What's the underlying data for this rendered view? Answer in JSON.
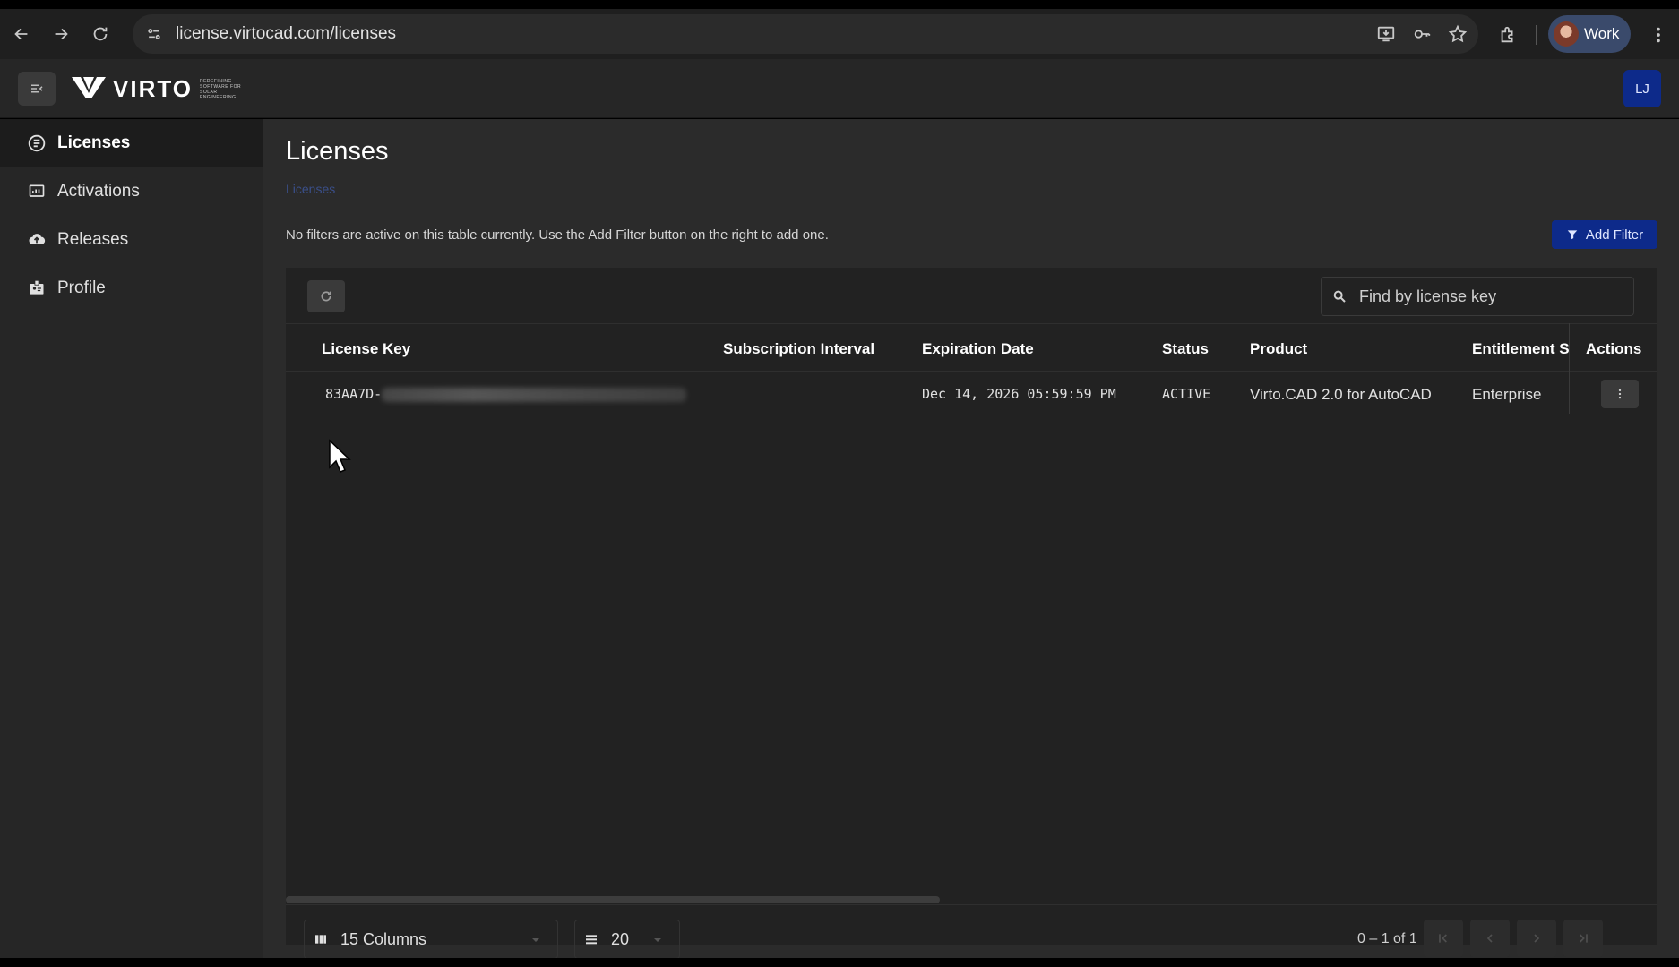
{
  "browser": {
    "url": "license.virtocad.com/licenses",
    "profile_name": "Work"
  },
  "header": {
    "logo_text": "VIRTO",
    "logo_tagline": "REDEFINING SOFTWARE FOR SOLAR ENGINEERING",
    "user_initials": "LJ"
  },
  "sidebar": {
    "items": [
      {
        "label": "Licenses",
        "icon": "list-circle-icon",
        "active": true
      },
      {
        "label": "Activations",
        "icon": "monitor-chart-icon",
        "active": false
      },
      {
        "label": "Releases",
        "icon": "cloud-upload-icon",
        "active": false
      },
      {
        "label": "Profile",
        "icon": "id-badge-icon",
        "active": false
      }
    ]
  },
  "main": {
    "title": "Licenses",
    "breadcrumb": "Licenses",
    "filter_note": "No filters are active on this table currently. Use the Add Filter button on the right to add one.",
    "add_filter_label": "Add Filter",
    "search_placeholder": "Find by license key",
    "columns": [
      "License Key",
      "Subscription Interval",
      "Expiration Date",
      "Status",
      "Product",
      "Entitlement Sets",
      "Actions"
    ],
    "rows": [
      {
        "license_key": "83AA7D-",
        "subscription_interval": "",
        "expiration_date": "Dec 14, 2026 05:59:59 PM",
        "status": "ACTIVE",
        "product": "Virto.CAD 2.0 for AutoCAD",
        "entitlement_sets": "Enterprise"
      }
    ],
    "columns_select": "15 Columns",
    "page_size": "20",
    "page_info": "0 – 1 of 1"
  },
  "colors": {
    "accent": "#0d2a8a",
    "background": "#2b2b2b",
    "sidebar": "#262626"
  }
}
